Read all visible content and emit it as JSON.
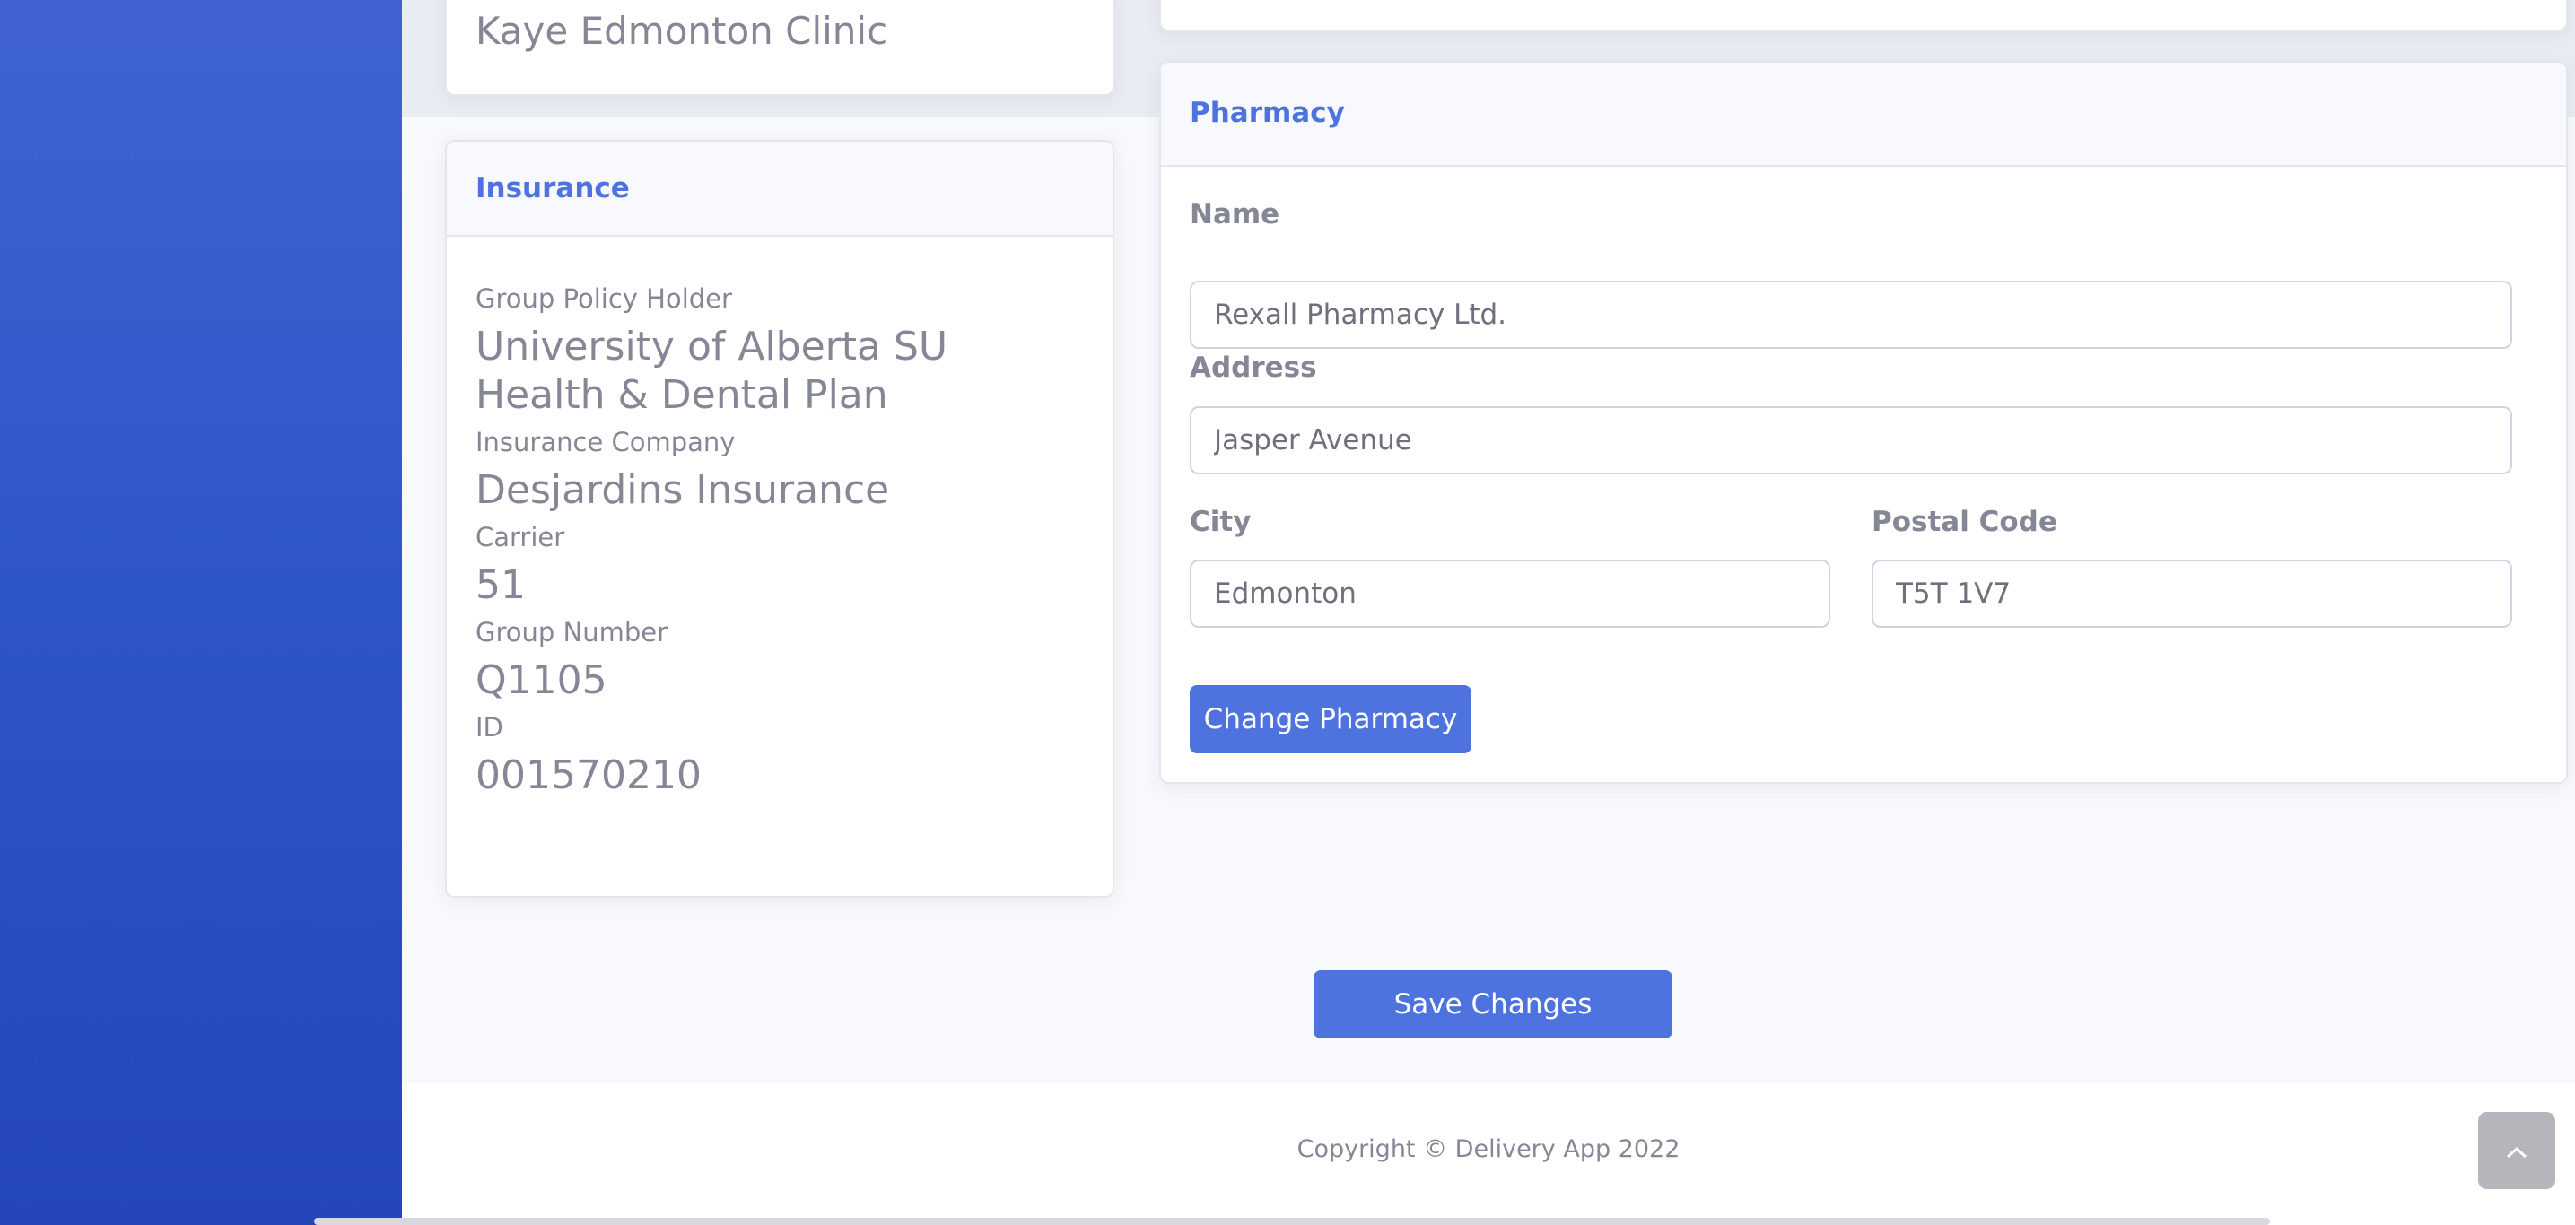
{
  "clinic": {
    "name": "Kaye Edmonton Clinic"
  },
  "insurance": {
    "header": "Insurance",
    "group_policy_holder_label": "Group Policy Holder",
    "group_policy_holder": "University of Alberta SU Health & Dental Plan",
    "insurance_company_label": "Insurance Company",
    "insurance_company": "Desjardins Insurance",
    "carrier_label": "Carrier",
    "carrier": "51",
    "group_number_label": "Group Number",
    "group_number": "Q1105",
    "id_label": "ID",
    "id": "001570210"
  },
  "pharmacy": {
    "header": "Pharmacy",
    "name_label": "Name",
    "name_value": "Rexall Pharmacy Ltd.",
    "address_label": "Address",
    "address_value": "Jasper Avenue",
    "city_label": "City",
    "city_value": "Edmonton",
    "postal_code_label": "Postal Code",
    "postal_code_value": "T5T 1V7",
    "change_button": "Change Pharmacy"
  },
  "save_button": "Save Changes",
  "footer": {
    "copyright": "Copyright © Delivery App 2022"
  },
  "icons": {
    "scroll_top": "chevron-up-icon"
  },
  "colors": {
    "primary": "#4e73df",
    "sidebar": "#2e55c8",
    "text": "#858796"
  }
}
